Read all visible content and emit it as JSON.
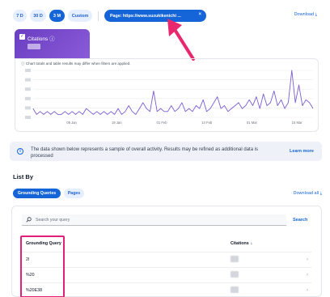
{
  "date_range": {
    "options": [
      "7 D",
      "30 D",
      "3 M",
      "Custom"
    ],
    "selected": "3 M"
  },
  "filter_chip": {
    "label": "Page: https://www.suzukikenichi ...",
    "close_icon": "×"
  },
  "download_label": "Download",
  "metric": {
    "label": "Citations",
    "info_icon": "ⓘ",
    "checked": true
  },
  "chart": {
    "note": "Chart totals and table results may differ when filters are applied.",
    "x_ticks": [
      "06 Jan",
      "19 Jan",
      "01 Feb",
      "14 Feb",
      "01 Mar",
      "15 Mar"
    ],
    "series_color": "#7c5ccf"
  },
  "chart_data": {
    "type": "line",
    "title": "",
    "xlabel": "",
    "ylabel": "",
    "x_tick_labels": [
      "06 Jan",
      "19 Jan",
      "01 Feb",
      "14 Feb",
      "01 Mar",
      "15 Mar"
    ],
    "series": [
      {
        "values": [
          3,
          1,
          2,
          1,
          2,
          1,
          2,
          1,
          1,
          2,
          1,
          2,
          1,
          2,
          1,
          3,
          2,
          1,
          2,
          1,
          2,
          1,
          2,
          1,
          3,
          1,
          2,
          4,
          2,
          1,
          3,
          5,
          3,
          2,
          9,
          2,
          3,
          2,
          2,
          4,
          2,
          3,
          5,
          2,
          3,
          2,
          4,
          3,
          6,
          2,
          3,
          5,
          7,
          3,
          4,
          2,
          3,
          4,
          5,
          3,
          4,
          6,
          4,
          7,
          3,
          8,
          4,
          5,
          9,
          4,
          6,
          3,
          5,
          16,
          5,
          11,
          4,
          6,
          5,
          3
        ]
      }
    ],
    "grid": true
  },
  "banner": {
    "text": "The data shown below represents a sample of overall activity. Results may be refined as additional data is processed",
    "link": "Learn more",
    "info_icon": "i"
  },
  "list_by": {
    "title": "List By",
    "tabs": [
      "Grounding Queries",
      "Pages"
    ],
    "selected_tab": "Grounding Queries",
    "download_all": "Download all"
  },
  "search": {
    "placeholder": "Search your query",
    "button": "Search"
  },
  "table": {
    "headers": [
      "Grounding Query",
      "Citations"
    ],
    "sort_icon": "↓",
    "rows": [
      {
        "query": "2l"
      },
      {
        "query": "%20"
      },
      {
        "query": "%20E38"
      }
    ]
  },
  "colors": {
    "accent": "#1565d8",
    "metric": "#6a3ec2",
    "highlight": "#e0207a"
  }
}
